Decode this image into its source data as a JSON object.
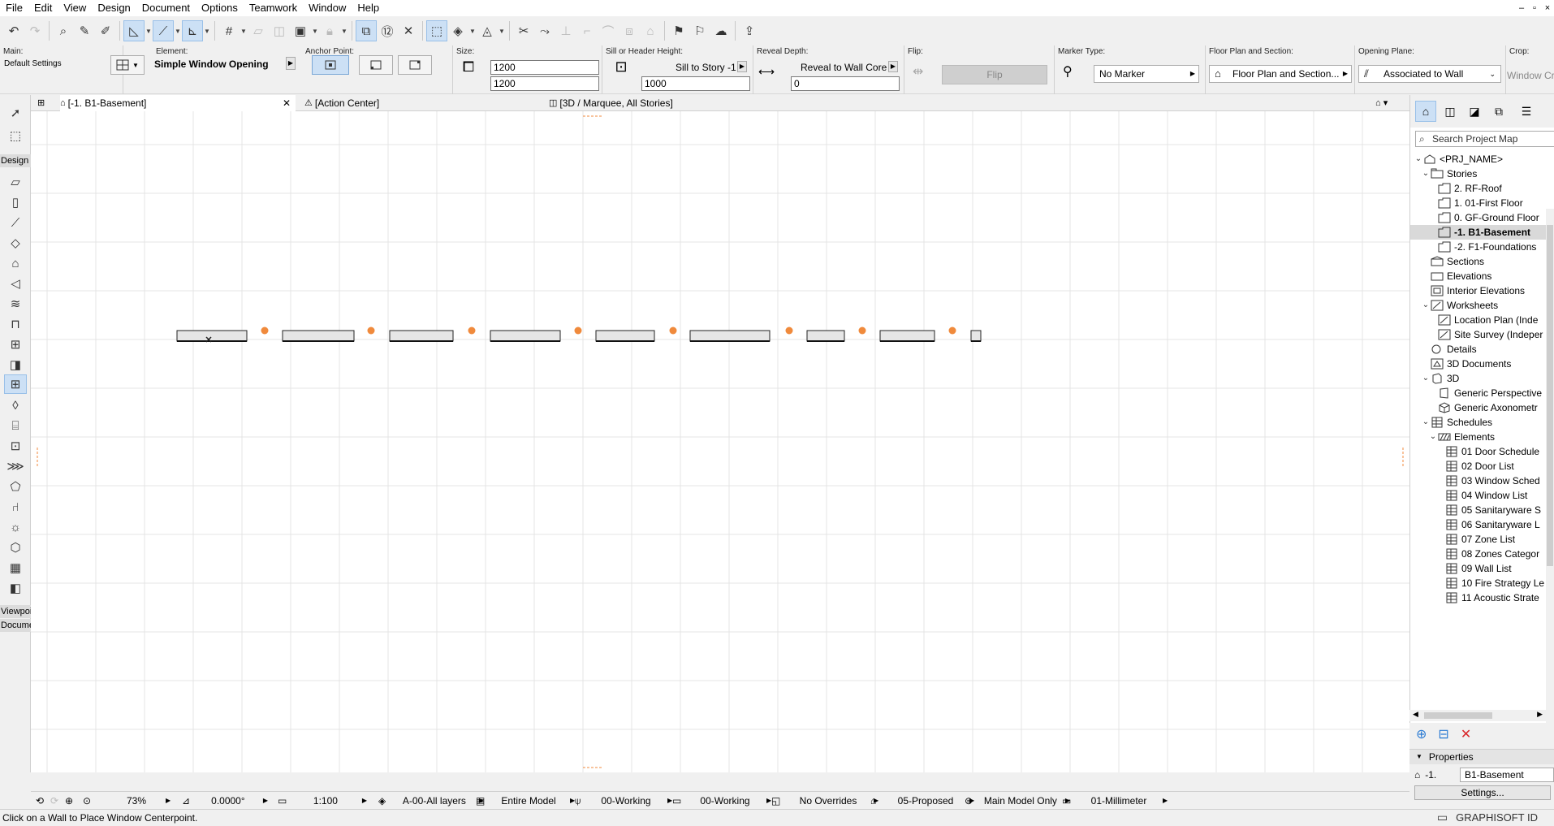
{
  "menu": [
    "File",
    "Edit",
    "View",
    "Design",
    "Document",
    "Options",
    "Teamwork",
    "Window",
    "Help"
  ],
  "window_controls": [
    "–",
    "▫",
    "×"
  ],
  "infobox": {
    "main_label": "Main:",
    "main_value": "Default Settings",
    "element_label": "Element:",
    "element_value": "Simple Window Opening",
    "anchor_label": "Anchor Point:",
    "size_label": "Size:",
    "size_width": "1200",
    "size_height": "1200",
    "sill_label": "Sill or Header Height:",
    "sill_mode": "Sill to Story -1",
    "sill_value": "1000",
    "reveal_label": "Reveal Depth:",
    "reveal_mode": "Reveal to Wall Core",
    "reveal_value": "0",
    "flip_label": "Flip:",
    "flip_button": "Flip",
    "marker_label": "Marker Type:",
    "marker_value": "No Marker",
    "fps_label": "Floor Plan and Section:",
    "fps_value": "Floor Plan and Section...",
    "plane_label": "Opening Plane:",
    "plane_value": "Associated to Wall",
    "crop_label": "Crop:",
    "crop_value": "Window Cr"
  },
  "tabs": {
    "tab1": "[-1. B1-Basement]",
    "tab2": "[Action Center]",
    "tab3": "[3D / Marquee, All Stories]"
  },
  "toolbox": {
    "group_design": "Design",
    "group_viewpoint": "Viewpoi",
    "group_document": "Docume"
  },
  "quick_options": {
    "zoom": "73%",
    "angle": "0.0000°",
    "scale": "1:100",
    "layers": "A-00-All layers",
    "model_view": "Entire Model",
    "pen_set": "00-Working",
    "mvo": "00-Working",
    "overrides": "No Overrides",
    "renovation": "05-Proposed",
    "structure": "Main Model Only",
    "dimension": "01-Millimeter"
  },
  "status": {
    "message": "Click on a Wall to Place Window Centerpoint.",
    "brand": "GRAPHISOFT ID"
  },
  "navigator": {
    "search_placeholder": "Search Project Map",
    "items": [
      {
        "label": "<PRJ_NAME>",
        "indent": 0,
        "chev": "v",
        "icon": "project"
      },
      {
        "label": "Stories",
        "indent": 1,
        "chev": "v",
        "icon": "folder"
      },
      {
        "label": "2. RF-Roof",
        "indent": 2,
        "chev": "",
        "icon": "story"
      },
      {
        "label": "1. 01-First Floor",
        "indent": 2,
        "chev": "",
        "icon": "story"
      },
      {
        "label": "0. GF-Ground Floor",
        "indent": 2,
        "chev": "",
        "icon": "story"
      },
      {
        "label": "-1. B1-Basement",
        "indent": 2,
        "chev": "",
        "icon": "story",
        "selected": true
      },
      {
        "label": "-2. F1-Foundations",
        "indent": 2,
        "chev": "",
        "icon": "story"
      },
      {
        "label": "Sections",
        "indent": 1,
        "chev": "",
        "icon": "section"
      },
      {
        "label": "Elevations",
        "indent": 1,
        "chev": "",
        "icon": "elevation"
      },
      {
        "label": "Interior Elevations",
        "indent": 1,
        "chev": "",
        "icon": "ie"
      },
      {
        "label": "Worksheets",
        "indent": 1,
        "chev": "v",
        "icon": "worksheet"
      },
      {
        "label": "Location Plan (Inde",
        "indent": 2,
        "chev": "",
        "icon": "worksheet"
      },
      {
        "label": "Site Survey (Indeper",
        "indent": 2,
        "chev": "",
        "icon": "worksheet"
      },
      {
        "label": "Details",
        "indent": 1,
        "chev": "",
        "icon": "detail"
      },
      {
        "label": "3D Documents",
        "indent": 1,
        "chev": "",
        "icon": "doc3d"
      },
      {
        "label": "3D",
        "indent": 1,
        "chev": "v",
        "icon": "cube"
      },
      {
        "label": "Generic Perspective",
        "indent": 2,
        "chev": "",
        "icon": "persp"
      },
      {
        "label": "Generic Axonometr",
        "indent": 2,
        "chev": "",
        "icon": "axo"
      },
      {
        "label": "Schedules",
        "indent": 1,
        "chev": "v",
        "icon": "table"
      },
      {
        "label": "Elements",
        "indent": 2,
        "chev": "v",
        "icon": "hatch"
      },
      {
        "label": "01 Door Schedule",
        "indent": 3,
        "chev": "",
        "icon": "table"
      },
      {
        "label": "02 Door List",
        "indent": 3,
        "chev": "",
        "icon": "table"
      },
      {
        "label": "03 Window Sched",
        "indent": 3,
        "chev": "",
        "icon": "table"
      },
      {
        "label": "04 Window List",
        "indent": 3,
        "chev": "",
        "icon": "table"
      },
      {
        "label": "05 Sanitaryware S",
        "indent": 3,
        "chev": "",
        "icon": "table"
      },
      {
        "label": "06 Sanitaryware L",
        "indent": 3,
        "chev": "",
        "icon": "table"
      },
      {
        "label": "07 Zone List",
        "indent": 3,
        "chev": "",
        "icon": "table"
      },
      {
        "label": "08 Zones Categor",
        "indent": 3,
        "chev": "",
        "icon": "table"
      },
      {
        "label": "09 Wall List",
        "indent": 3,
        "chev": "",
        "icon": "table"
      },
      {
        "label": "10 Fire Strategy Le",
        "indent": 3,
        "chev": "",
        "icon": "table"
      },
      {
        "label": "11 Acoustic Strate",
        "indent": 3,
        "chev": "",
        "icon": "table"
      }
    ]
  },
  "properties": {
    "header": "Properties",
    "story_no": "-1.",
    "story_name": "B1-Basement",
    "settings_button": "Settings..."
  },
  "colors": {
    "accent_orange": "#f08a3c",
    "selection_blue": "#cce0f5",
    "grid": "#e4e4e4"
  }
}
